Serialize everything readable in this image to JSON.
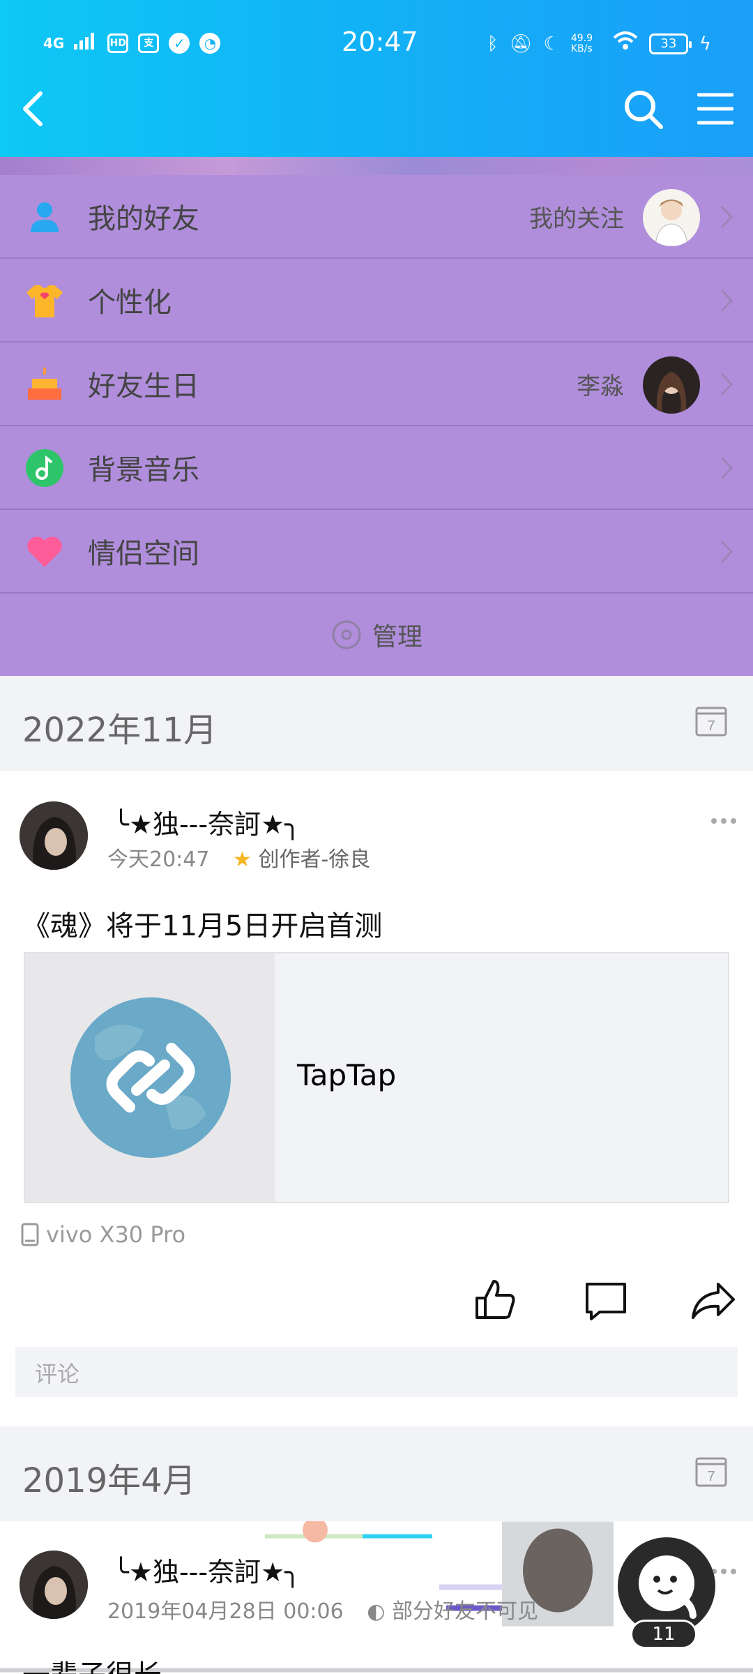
{
  "status_bar": {
    "network": "4G",
    "hd": "HD",
    "pay_icon": "alipay-icon",
    "time": "20:47",
    "speed": "49.9 KB/s",
    "battery": "33"
  },
  "nav": {
    "back_icon": "back-arrow-icon",
    "search_icon": "search-icon",
    "menu_icon": "hamburger-menu-icon"
  },
  "menu": {
    "items": [
      {
        "label": "我的好友",
        "right": "我的关注",
        "icon": "friends-icon"
      },
      {
        "label": "个性化",
        "right": "",
        "icon": "shirt-icon"
      },
      {
        "label": "好友生日",
        "right": "李淼",
        "icon": "cake-icon"
      },
      {
        "label": "背景音乐",
        "right": "",
        "icon": "music-icon"
      },
      {
        "label": "情侣空间",
        "right": "",
        "icon": "heart-icon"
      }
    ],
    "manage_label": "管理"
  },
  "sections": [
    {
      "date": "2022年11月"
    },
    {
      "date": "2019年4月"
    }
  ],
  "post1": {
    "author": "╰★独---奈訶★╮",
    "time": "今天20:47",
    "badge": "创作者-徐良",
    "text": "《魂》将于11月5日开启首测",
    "link_title": "TapTap",
    "device": "vivo X30 Pro",
    "comment_placeholder": "评论"
  },
  "post2": {
    "author": "╰★独---奈訶★╮",
    "time": "2019年04月28日 00:06",
    "visibility": "部分好友不可见",
    "text": "一辈子很长"
  },
  "fab": {
    "count": "11"
  },
  "colors": {
    "topbar": "#12b3f6",
    "panel": "#b08edb",
    "background": "#f2f3f7"
  }
}
